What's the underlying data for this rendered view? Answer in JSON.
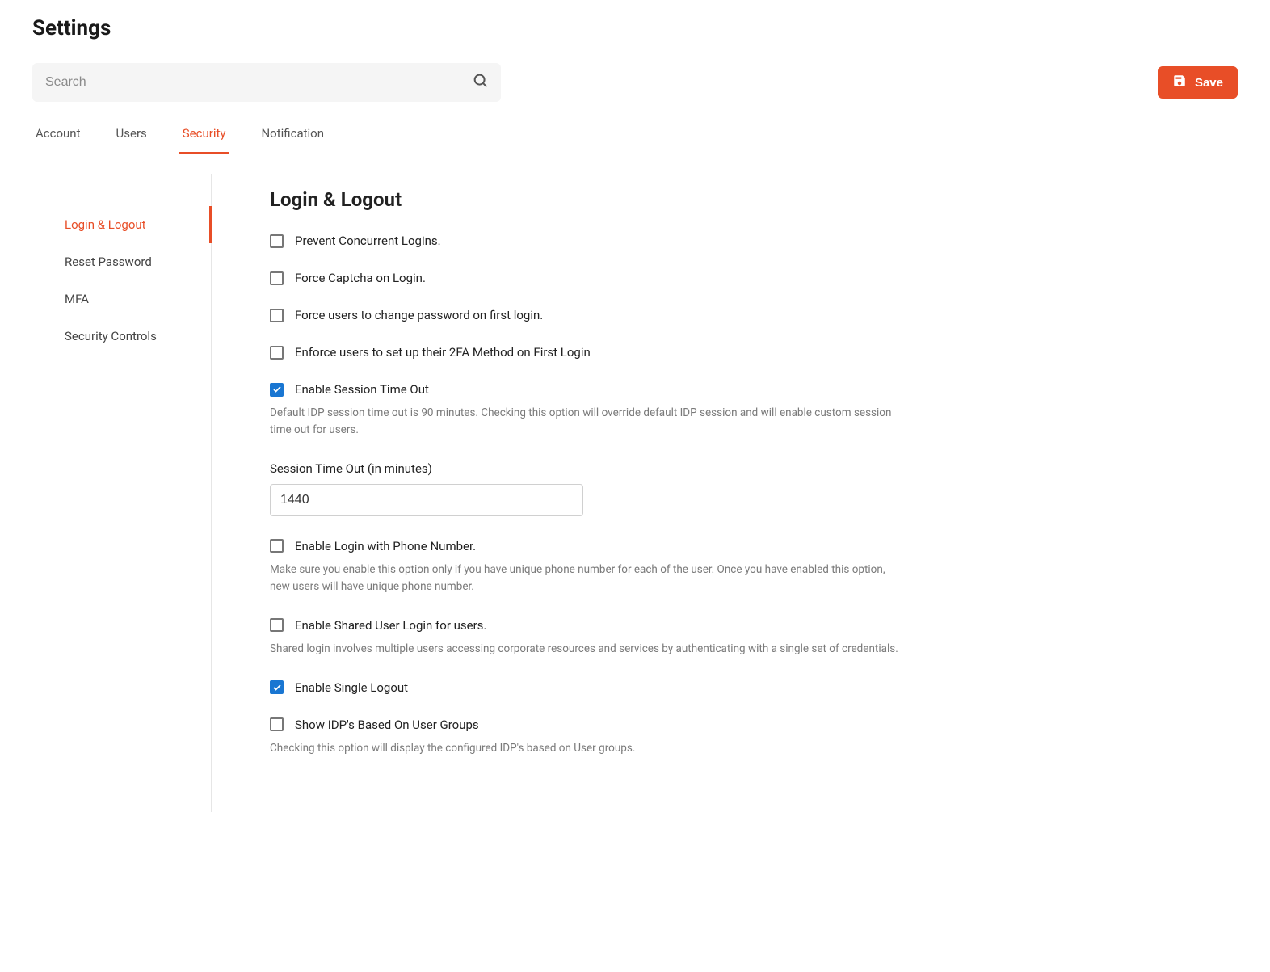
{
  "page": {
    "title": "Settings"
  },
  "search": {
    "placeholder": "Search",
    "value": ""
  },
  "toolbar": {
    "save_label": "Save"
  },
  "tabs": [
    {
      "label": "Account",
      "active": false
    },
    {
      "label": "Users",
      "active": false
    },
    {
      "label": "Security",
      "active": true
    },
    {
      "label": "Notification",
      "active": false
    }
  ],
  "sidebar": {
    "items": [
      {
        "label": "Login & Logout",
        "active": true
      },
      {
        "label": "Reset Password",
        "active": false
      },
      {
        "label": "MFA",
        "active": false
      },
      {
        "label": "Security Controls",
        "active": false
      }
    ]
  },
  "section": {
    "title": "Login & Logout"
  },
  "options": {
    "prevent_concurrent": {
      "label": "Prevent Concurrent Logins.",
      "checked": false
    },
    "force_captcha": {
      "label": "Force Captcha on Login.",
      "checked": false
    },
    "force_password_change": {
      "label": "Force users to change password on first login.",
      "checked": false
    },
    "enforce_2fa": {
      "label": "Enforce users to set up their 2FA Method on First Login",
      "checked": false
    },
    "session_timeout": {
      "label": "Enable Session Time Out",
      "checked": true,
      "description": "Default IDP session time out is 90 minutes. Checking this option will override default IDP session and will enable custom session time out for users."
    },
    "session_timeout_field": {
      "label": "Session Time Out (in minutes)",
      "value": "1440"
    },
    "login_phone": {
      "label": "Enable Login with Phone Number.",
      "checked": false,
      "description": "Make sure you enable this option only if you have unique phone number for each of the user. Once you have enabled this option, new users will have unique phone number."
    },
    "shared_user": {
      "label": "Enable Shared User Login for users.",
      "checked": false,
      "description": "Shared login involves multiple users accessing corporate resources and services by authenticating with a single set of credentials."
    },
    "single_logout": {
      "label": "Enable Single Logout",
      "checked": true
    },
    "show_idp": {
      "label": "Show IDP's Based On User Groups",
      "checked": false,
      "description": "Checking this option will display the configured IDP's based on User groups."
    }
  }
}
